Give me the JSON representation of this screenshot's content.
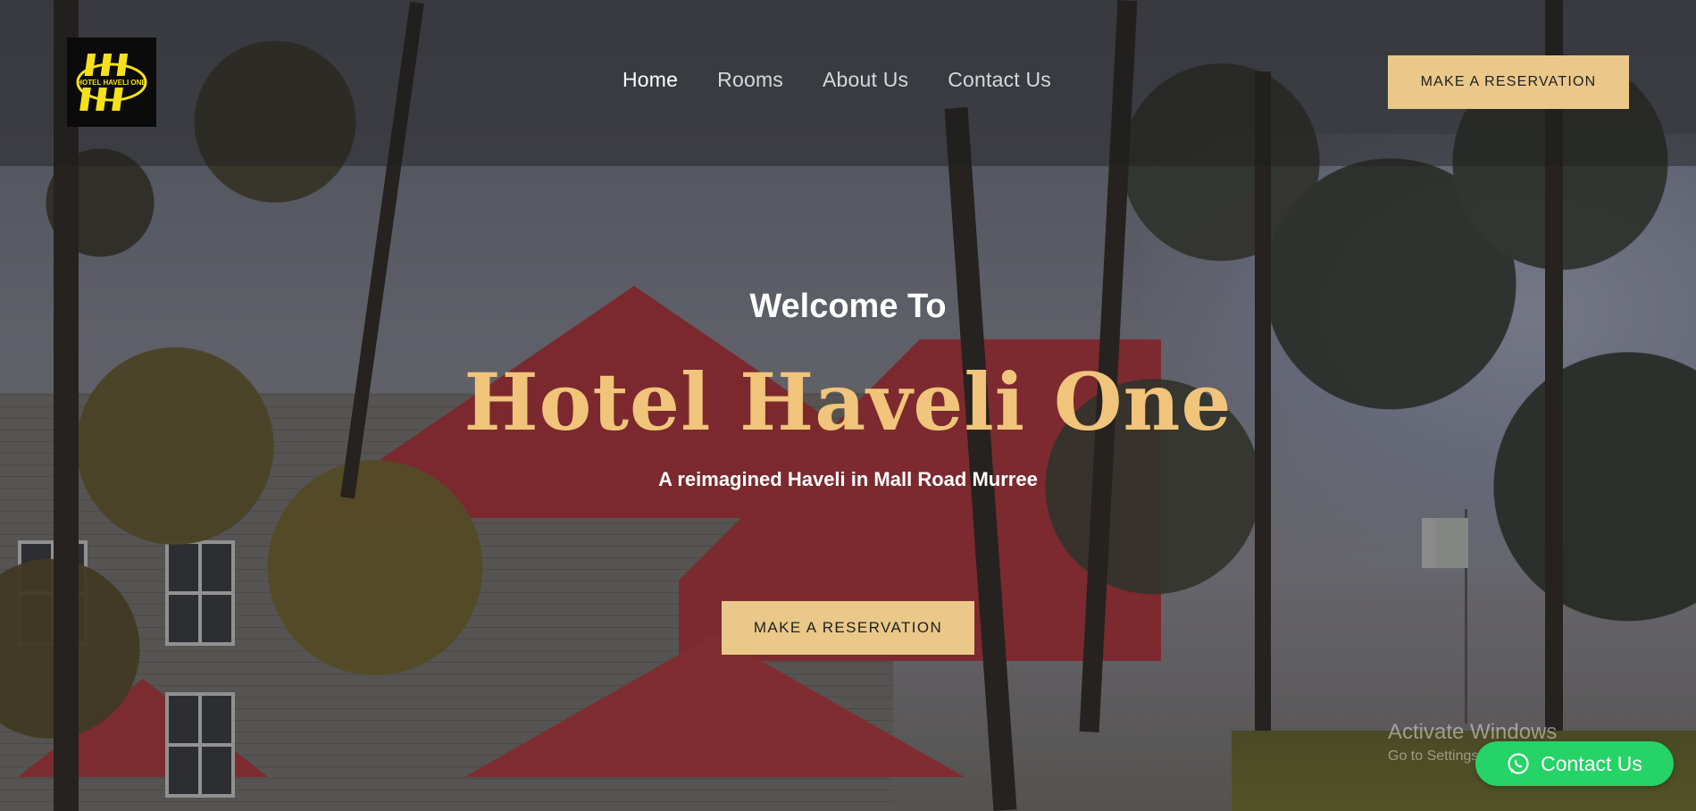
{
  "header": {
    "logo_text": "HOTEL HAVELI ONE",
    "nav": [
      {
        "label": "Home",
        "active": true
      },
      {
        "label": "Rooms",
        "active": false
      },
      {
        "label": "About Us",
        "active": false
      },
      {
        "label": "Contact Us",
        "active": false
      }
    ],
    "reservation_button": "MAKE A RESERVATION"
  },
  "hero": {
    "welcome": "Welcome To",
    "title": "Hotel Haveli One",
    "tagline": "A reimagined Haveli in Mall Road Murree",
    "cta": "MAKE A RESERVATION"
  },
  "watermark": {
    "line1": "Activate Windows",
    "line2": "Go to Settings to activate Windows."
  },
  "contact_fab": {
    "label": "Contact Us",
    "icon": "whatsapp-icon"
  },
  "colors": {
    "accent_gold": "#e9c88a",
    "title_gold": "#f0c47a",
    "whatsapp_green": "#25d366",
    "logo_yellow": "#f5e11a"
  }
}
